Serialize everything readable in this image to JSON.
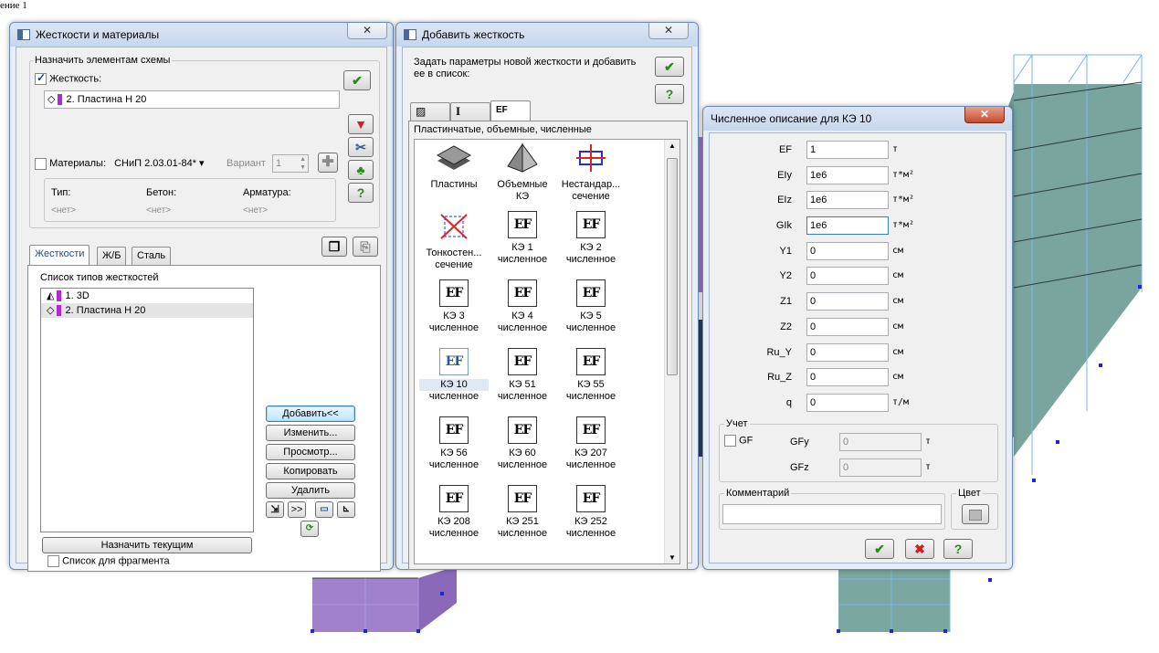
{
  "corner_text": "ение 1",
  "win1": {
    "title": "Жесткости и материалы",
    "assign_group": "Назначить элементам схемы",
    "stiffness_label": "Жесткость:",
    "stiffness_checked": true,
    "stiffness_value": "2. Пластина  H 20",
    "materials_label": "Материалы:",
    "materials_checked": false,
    "materials_code": "СНиП 2.03.01-84*",
    "variant_label": "Вариант",
    "variant_value": "1",
    "table_headers": [
      "Тип:",
      "Бетон:",
      "Арматура:"
    ],
    "table_values": [
      "<нет>",
      "<нет>",
      "<нет>"
    ],
    "tabs": [
      "Жесткости",
      "Ж/Б",
      "Сталь"
    ],
    "list_title": "Список типов жесткостей",
    "list_items": [
      "1. 3D",
      "2. Пластина  H 20"
    ],
    "buttons": {
      "add": "Добавить<<",
      "edit": "Изменить...",
      "view": "Просмотр...",
      "copy": "Копировать",
      "delete": "Удалить",
      "assign_current": "Назначить текущим",
      "fwd": ">>"
    },
    "fragment_label": "Список для фрагмента",
    "fragment_checked": false
  },
  "win2": {
    "title": "Добавить жесткость",
    "description": "Задать параметры новой жесткости и добавить ее в список:",
    "tab_labels": [
      "",
      "I",
      "EF"
    ],
    "section_title": "Пластинчатые, объемные, численные",
    "tiles": [
      [
        "Пластины",
        ""
      ],
      [
        "Объемные",
        "КЭ"
      ],
      [
        "Нестандар...",
        "сечение"
      ],
      [
        "Тонкостен...",
        "сечение"
      ],
      [
        "КЭ 1",
        "численное"
      ],
      [
        "КЭ 2",
        "численное"
      ],
      [
        "КЭ 3",
        "численное"
      ],
      [
        "КЭ 4",
        "численное"
      ],
      [
        "КЭ 5",
        "численное"
      ],
      [
        "КЭ 10",
        "численное"
      ],
      [
        "КЭ 51",
        "численное"
      ],
      [
        "КЭ 55",
        "численное"
      ],
      [
        "КЭ 56",
        "численное"
      ],
      [
        "КЭ 60",
        "численное"
      ],
      [
        "КЭ 207",
        "численное"
      ],
      [
        "КЭ 208",
        "численное"
      ],
      [
        "КЭ 251",
        "численное"
      ],
      [
        "КЭ 252",
        "численное"
      ]
    ],
    "ef_glyph": "EF",
    "selected_tile": "КЭ 10"
  },
  "win3": {
    "title": "Численное описание для КЭ 10",
    "params": [
      {
        "label": "EF",
        "value": "1",
        "unit": "т"
      },
      {
        "label": "EIy",
        "value": "1e6",
        "unit": "т*м²"
      },
      {
        "label": "EIz",
        "value": "1e6",
        "unit": "т*м²"
      },
      {
        "label": "GIk",
        "value": "1e6",
        "unit": "т*м²"
      },
      {
        "label": "Y1",
        "value": "0",
        "unit": "см"
      },
      {
        "label": "Y2",
        "value": "0",
        "unit": "см"
      },
      {
        "label": "Z1",
        "value": "0",
        "unit": "см"
      },
      {
        "label": "Z2",
        "value": "0",
        "unit": "см"
      },
      {
        "label": "Ru_Y",
        "value": "0",
        "unit": "см"
      },
      {
        "label": "Ru_Z",
        "value": "0",
        "unit": "см"
      },
      {
        "label": "q",
        "value": "0",
        "unit": "т/м"
      }
    ],
    "account_group": "Учет",
    "gf_label": "GF",
    "gf_checked": false,
    "gfy_label": "GFy",
    "gfy_value": "0",
    "gfy_unit": "т",
    "gfz_label": "GFz",
    "gfz_value": "0",
    "gfz_unit": "т",
    "comment_label": "Комментарий",
    "comment_value": "",
    "color_label": "Цвет"
  },
  "colors": {
    "teal_model": "#6d9a93",
    "purple_model": "#9b7bc9",
    "accent_blue": "#1a4c96",
    "check_green": "#2a8a1a"
  }
}
